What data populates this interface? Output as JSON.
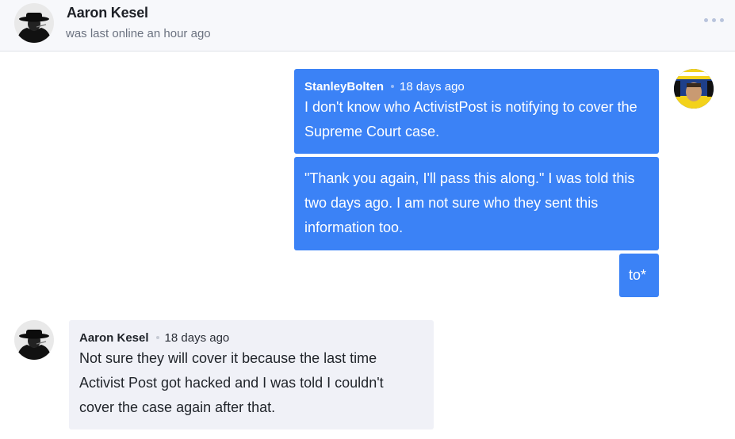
{
  "header": {
    "name": "Aaron Kesel",
    "status": "was last online an hour ago",
    "more_icon": "more-horizontal-icon"
  },
  "messages": [
    {
      "author": "StanleyBolten",
      "time": "18 days ago",
      "direction": "outgoing",
      "lines": [
        "I don't know who ActivistPost is notifying to cover the",
        "Supreme Court case."
      ]
    },
    {
      "direction": "outgoing",
      "lines": [
        "\"Thank you again, I'll pass this along.\" I was told this",
        "two days ago. I am not sure who they sent this",
        "information too."
      ]
    },
    {
      "direction": "outgoing",
      "lines": [
        "to*"
      ]
    },
    {
      "author": "Aaron Kesel",
      "time": "18 days ago",
      "direction": "incoming",
      "lines": [
        "Not sure they will cover it because the last time",
        "Activist Post got hacked and I was told I couldn't",
        "cover the case again after that."
      ]
    }
  ],
  "colors": {
    "outgoing_bubble": "#3b82f6",
    "incoming_bubble": "#f0f1f7",
    "header_bg": "#f7f8fb"
  }
}
